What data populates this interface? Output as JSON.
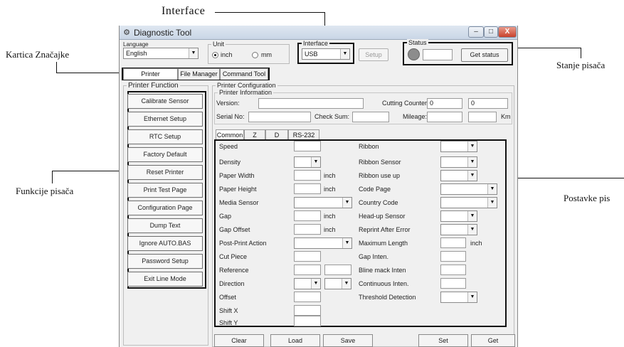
{
  "annotations": {
    "interface": "Interface",
    "kartica": "Kartica Značajke",
    "stanje": "Stanje pisača",
    "funkcije": "Funkcije pisača",
    "postavke": "Postavke pis"
  },
  "window": {
    "title": "Diagnostic Tool",
    "controls": {
      "minimize": "–",
      "maximize": "□",
      "close": "X"
    }
  },
  "language": {
    "label": "Language",
    "value": "English"
  },
  "unit": {
    "label": "Unit",
    "inch": "inch",
    "mm": "mm",
    "selected": "inch"
  },
  "interface": {
    "label": "Interface",
    "value": "USB"
  },
  "setup_button": "Setup",
  "status": {
    "label": "Status",
    "get_status_button": "Get status"
  },
  "tabs": [
    "Printer Configuration",
    "File Manager",
    "Command Tool"
  ],
  "printer_function": {
    "title": "Printer Function",
    "buttons": [
      "Calibrate Sensor",
      "Ethernet Setup",
      "RTC Setup",
      "Factory Default",
      "Reset Printer",
      "Print Test Page",
      "Configuration Page",
      "Dump Text",
      "Ignore AUTO.BAS",
      "Password Setup",
      "Exit Line Mode"
    ]
  },
  "printer_config": {
    "title": "Printer Configuration",
    "info_title": "Printer Information",
    "version": "Version:",
    "serial": "Serial No:",
    "checksum": "Check Sum:",
    "cutting_counter": "Cutting Counter:",
    "cutting_val1": "0",
    "cutting_val2": "0",
    "mileage": "Mileage:",
    "km": "Km"
  },
  "inner_tabs": [
    "Common",
    "Z",
    "D",
    "RS-232"
  ],
  "left_fields": [
    "Speed",
    "Density",
    "Paper Width",
    "Paper Height",
    "Media Sensor",
    "Gap",
    "Gap Offset",
    "Post-Print Action",
    "Cut Piece",
    "Reference",
    "Direction",
    "Offset",
    "Shift X",
    "Shift Y"
  ],
  "right_fields": [
    "Ribbon",
    "Ribbon Sensor",
    "Ribbon use up",
    "Code Page",
    "Country Code",
    "Head-up Sensor",
    "Reprint After Error",
    "Maximum Length",
    "Gap Inten.",
    "Bline mack Inten",
    "Continuous Inten.",
    "Threshold Detection"
  ],
  "units": {
    "inch": "inch"
  },
  "bottom_buttons": [
    "Clear",
    "Load",
    "Save",
    "Set",
    "Get"
  ]
}
